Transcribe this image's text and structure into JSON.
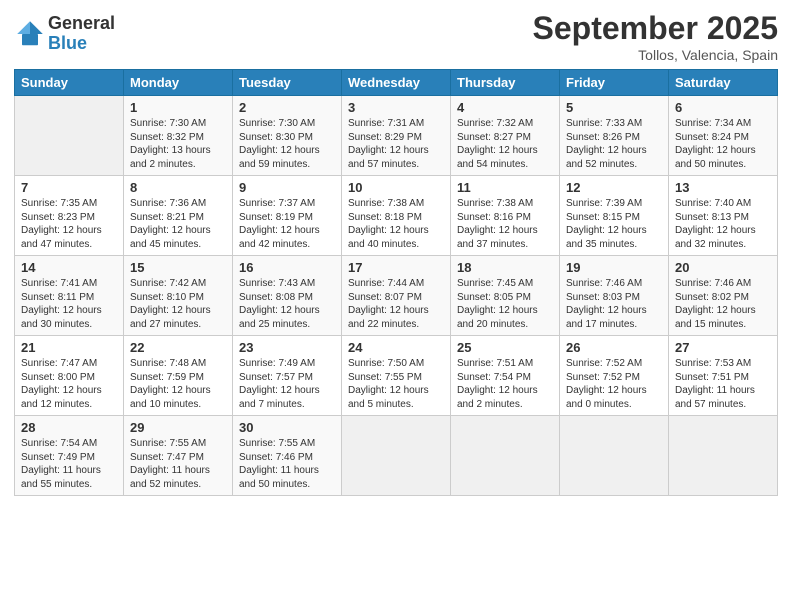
{
  "logo": {
    "general": "General",
    "blue": "Blue"
  },
  "header": {
    "month": "September 2025",
    "location": "Tollos, Valencia, Spain"
  },
  "days_of_week": [
    "Sunday",
    "Monday",
    "Tuesday",
    "Wednesday",
    "Thursday",
    "Friday",
    "Saturday"
  ],
  "weeks": [
    [
      {
        "num": "",
        "info": ""
      },
      {
        "num": "1",
        "info": "Sunrise: 7:30 AM\nSunset: 8:32 PM\nDaylight: 13 hours\nand 2 minutes."
      },
      {
        "num": "2",
        "info": "Sunrise: 7:30 AM\nSunset: 8:30 PM\nDaylight: 12 hours\nand 59 minutes."
      },
      {
        "num": "3",
        "info": "Sunrise: 7:31 AM\nSunset: 8:29 PM\nDaylight: 12 hours\nand 57 minutes."
      },
      {
        "num": "4",
        "info": "Sunrise: 7:32 AM\nSunset: 8:27 PM\nDaylight: 12 hours\nand 54 minutes."
      },
      {
        "num": "5",
        "info": "Sunrise: 7:33 AM\nSunset: 8:26 PM\nDaylight: 12 hours\nand 52 minutes."
      },
      {
        "num": "6",
        "info": "Sunrise: 7:34 AM\nSunset: 8:24 PM\nDaylight: 12 hours\nand 50 minutes."
      }
    ],
    [
      {
        "num": "7",
        "info": "Sunrise: 7:35 AM\nSunset: 8:23 PM\nDaylight: 12 hours\nand 47 minutes."
      },
      {
        "num": "8",
        "info": "Sunrise: 7:36 AM\nSunset: 8:21 PM\nDaylight: 12 hours\nand 45 minutes."
      },
      {
        "num": "9",
        "info": "Sunrise: 7:37 AM\nSunset: 8:19 PM\nDaylight: 12 hours\nand 42 minutes."
      },
      {
        "num": "10",
        "info": "Sunrise: 7:38 AM\nSunset: 8:18 PM\nDaylight: 12 hours\nand 40 minutes."
      },
      {
        "num": "11",
        "info": "Sunrise: 7:38 AM\nSunset: 8:16 PM\nDaylight: 12 hours\nand 37 minutes."
      },
      {
        "num": "12",
        "info": "Sunrise: 7:39 AM\nSunset: 8:15 PM\nDaylight: 12 hours\nand 35 minutes."
      },
      {
        "num": "13",
        "info": "Sunrise: 7:40 AM\nSunset: 8:13 PM\nDaylight: 12 hours\nand 32 minutes."
      }
    ],
    [
      {
        "num": "14",
        "info": "Sunrise: 7:41 AM\nSunset: 8:11 PM\nDaylight: 12 hours\nand 30 minutes."
      },
      {
        "num": "15",
        "info": "Sunrise: 7:42 AM\nSunset: 8:10 PM\nDaylight: 12 hours\nand 27 minutes."
      },
      {
        "num": "16",
        "info": "Sunrise: 7:43 AM\nSunset: 8:08 PM\nDaylight: 12 hours\nand 25 minutes."
      },
      {
        "num": "17",
        "info": "Sunrise: 7:44 AM\nSunset: 8:07 PM\nDaylight: 12 hours\nand 22 minutes."
      },
      {
        "num": "18",
        "info": "Sunrise: 7:45 AM\nSunset: 8:05 PM\nDaylight: 12 hours\nand 20 minutes."
      },
      {
        "num": "19",
        "info": "Sunrise: 7:46 AM\nSunset: 8:03 PM\nDaylight: 12 hours\nand 17 minutes."
      },
      {
        "num": "20",
        "info": "Sunrise: 7:46 AM\nSunset: 8:02 PM\nDaylight: 12 hours\nand 15 minutes."
      }
    ],
    [
      {
        "num": "21",
        "info": "Sunrise: 7:47 AM\nSunset: 8:00 PM\nDaylight: 12 hours\nand 12 minutes."
      },
      {
        "num": "22",
        "info": "Sunrise: 7:48 AM\nSunset: 7:59 PM\nDaylight: 12 hours\nand 10 minutes."
      },
      {
        "num": "23",
        "info": "Sunrise: 7:49 AM\nSunset: 7:57 PM\nDaylight: 12 hours\nand 7 minutes."
      },
      {
        "num": "24",
        "info": "Sunrise: 7:50 AM\nSunset: 7:55 PM\nDaylight: 12 hours\nand 5 minutes."
      },
      {
        "num": "25",
        "info": "Sunrise: 7:51 AM\nSunset: 7:54 PM\nDaylight: 12 hours\nand 2 minutes."
      },
      {
        "num": "26",
        "info": "Sunrise: 7:52 AM\nSunset: 7:52 PM\nDaylight: 12 hours\nand 0 minutes."
      },
      {
        "num": "27",
        "info": "Sunrise: 7:53 AM\nSunset: 7:51 PM\nDaylight: 11 hours\nand 57 minutes."
      }
    ],
    [
      {
        "num": "28",
        "info": "Sunrise: 7:54 AM\nSunset: 7:49 PM\nDaylight: 11 hours\nand 55 minutes."
      },
      {
        "num": "29",
        "info": "Sunrise: 7:55 AM\nSunset: 7:47 PM\nDaylight: 11 hours\nand 52 minutes."
      },
      {
        "num": "30",
        "info": "Sunrise: 7:55 AM\nSunset: 7:46 PM\nDaylight: 11 hours\nand 50 minutes."
      },
      {
        "num": "",
        "info": ""
      },
      {
        "num": "",
        "info": ""
      },
      {
        "num": "",
        "info": ""
      },
      {
        "num": "",
        "info": ""
      }
    ]
  ]
}
